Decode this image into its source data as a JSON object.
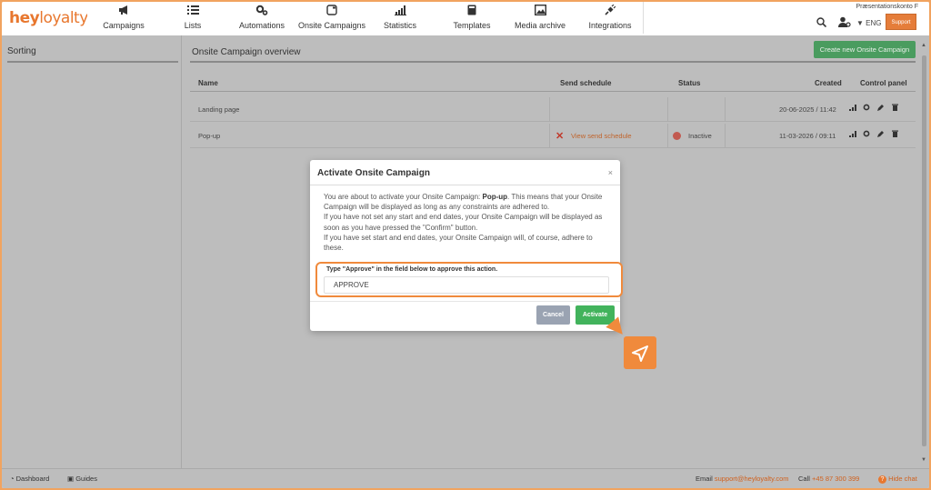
{
  "brand": {
    "part1": "hey",
    "part2": "loyalty"
  },
  "nav": [
    {
      "label": "Campaigns",
      "icon": "megaphone-icon"
    },
    {
      "label": "Lists",
      "icon": "list-icon"
    },
    {
      "label": "Automations",
      "icon": "gears-icon"
    },
    {
      "label": "Onsite Campaigns",
      "icon": "onsite-icon"
    },
    {
      "label": "Statistics",
      "icon": "statistics-icon"
    },
    {
      "label": "Templates",
      "icon": "template-icon"
    },
    {
      "label": "Media archive",
      "icon": "image-icon"
    },
    {
      "label": "Integrations",
      "icon": "plug-icon"
    }
  ],
  "header": {
    "account": "Præsentationskonto F",
    "language": "ENG",
    "support": "Support"
  },
  "sidebar": {
    "title": "Sorting"
  },
  "main": {
    "title": "Onsite Campaign overview",
    "create_button": "Create new Onsite Campaign",
    "columns": {
      "name": "Name",
      "send_schedule": "Send schedule",
      "status": "Status",
      "created": "Created",
      "control_panel": "Control panel"
    },
    "rows": [
      {
        "name": "Landing page",
        "schedule": "",
        "status": "",
        "created": "20-06-2025 / 11:42"
      },
      {
        "name": "Pop-up",
        "schedule": "View send schedule",
        "status": "Inactive",
        "created": "11-03-2026 / 09:11"
      }
    ]
  },
  "footer": {
    "dashboard": "Dashboard",
    "guides": "Guides",
    "email_label": "Email",
    "email": "support@heyloyalty.com",
    "call_label": "Call",
    "phone": "+45 87 300 399",
    "hide_chat": "Hide chat"
  },
  "modal": {
    "title": "Activate Onsite Campaign",
    "close": "×",
    "line1_a": "You are about to activate your Onsite Campaign: ",
    "line1_b": "Pop-up",
    "line1_c": ". This means that your Onsite Campaign will be displayed as long as any constraints are adhered to.",
    "line2": "If you have not set any start and end dates, your Onsite Campaign will be displayed as soon as you have pressed the \"Confirm\" button.",
    "line3": "If you have set start and end dates, your Onsite Campaign will, of course, adhere to these.",
    "approve_label": "Type \"Approve\" in the field below to approve this action.",
    "approve_value": "APPROVE",
    "cancel": "Cancel",
    "activate": "Activate"
  },
  "colors": {
    "accent": "#e8772e",
    "activate": "#42b35c",
    "highlight": "#f08a3c"
  }
}
